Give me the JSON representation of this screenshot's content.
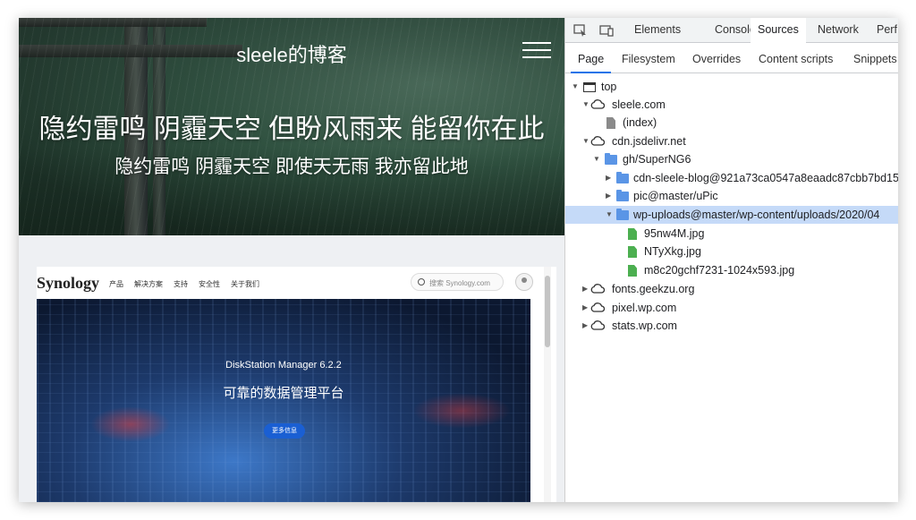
{
  "blog": {
    "title": "sleele的博客",
    "headline": "隐约雷鸣 阴霾天空 但盼风雨来 能留你在此",
    "subheadline": "隐约雷鸣 阴霾天空 即使天无雨 我亦留此地"
  },
  "synology": {
    "logo": "Synology",
    "nav": [
      "产品",
      "解决方案",
      "支持",
      "安全性",
      "关于我们"
    ],
    "search_placeholder": "搜索 Synology.com",
    "product": "DiskStation Manager 6.2.2",
    "slogan": "可靠的数据管理平台",
    "more_button": "更多信息"
  },
  "devtools": {
    "tabs": [
      "Elements",
      "Console",
      "Sources",
      "Network",
      "Perf"
    ],
    "active_tab": "Sources",
    "subtabs": [
      "Page",
      "Filesystem",
      "Overrides",
      "Content scripts",
      "Snippets"
    ],
    "active_subtab": "Page",
    "tree": [
      {
        "label": "top",
        "kind": "frame",
        "expanded": true
      },
      {
        "label": "sleele.com",
        "kind": "cloud",
        "expanded": true
      },
      {
        "label": "(index)",
        "kind": "file"
      },
      {
        "label": "cdn.jsdelivr.net",
        "kind": "cloud",
        "expanded": true
      },
      {
        "label": "gh/SuperNG6",
        "kind": "folder",
        "expanded": true
      },
      {
        "label": "cdn-sleele-blog@921a73ca0547a8eaadc87cbb7bd15",
        "kind": "folder",
        "expanded": false
      },
      {
        "label": "pic@master/uPic",
        "kind": "folder",
        "expanded": false
      },
      {
        "label": "wp-uploads@master/wp-content/uploads/2020/04",
        "kind": "folder",
        "expanded": true,
        "selected": true
      },
      {
        "label": "95nw4M.jpg",
        "kind": "image"
      },
      {
        "label": "NTyXkg.jpg",
        "kind": "image"
      },
      {
        "label": "m8c20gchf7231-1024x593.jpg",
        "kind": "image"
      },
      {
        "label": "fonts.geekzu.org",
        "kind": "cloud",
        "expanded": false
      },
      {
        "label": "pixel.wp.com",
        "kind": "cloud",
        "expanded": false
      },
      {
        "label": "stats.wp.com",
        "kind": "cloud",
        "expanded": false
      }
    ]
  }
}
